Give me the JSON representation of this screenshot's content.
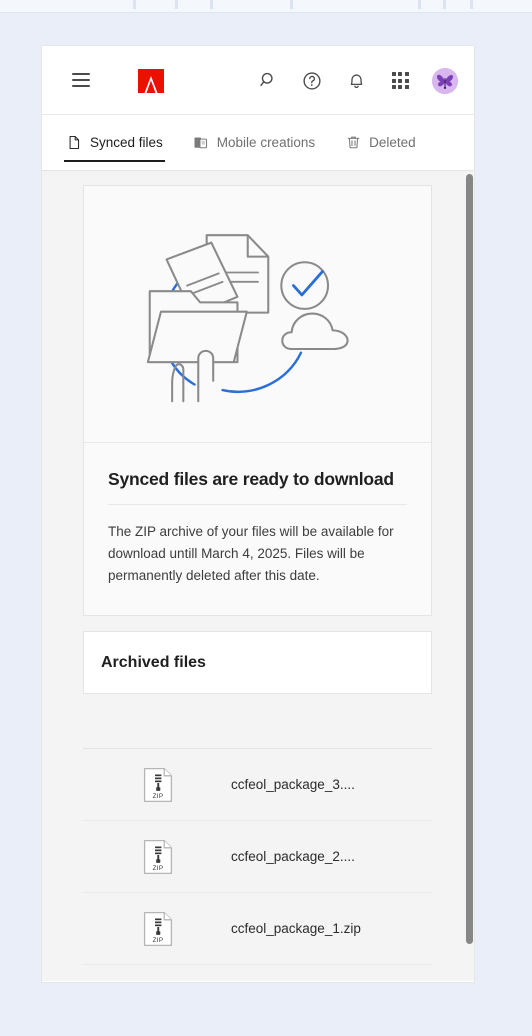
{
  "app": {
    "brand_logo": "adobe-logo",
    "accent_red": "#eb1000",
    "accent_blue": "#2a6fd6",
    "text_dark": "#1f1f1f",
    "text_muted": "#707070"
  },
  "header": {
    "menu_icon": "hamburger-menu-icon",
    "icons": [
      {
        "name": "search-icon",
        "label": "Search"
      },
      {
        "name": "help-icon",
        "label": "Help"
      },
      {
        "name": "notifications-bell-icon",
        "label": "Notifications"
      },
      {
        "name": "app-switcher-grid-icon",
        "label": "Apps"
      }
    ],
    "avatar": {
      "name": "user-avatar",
      "label": "Account"
    }
  },
  "tabs": [
    {
      "label": "Synced files",
      "icon": "document-icon",
      "active": true
    },
    {
      "label": "Mobile creations",
      "icon": "mobile-device-icon",
      "active": false
    },
    {
      "label": "Deleted",
      "icon": "trash-icon",
      "active": false
    }
  ],
  "hero": {
    "illustration": "sync-files-to-cloud-illustration",
    "title": "Synced files are ready to download",
    "body": "The ZIP archive of your files will be available for download untill March 4, 2025. Files will be permanently deleted after this date."
  },
  "archived": {
    "title": "Archived files"
  },
  "files": [
    {
      "name": "ccfeol_package_3....",
      "type": "ZIP",
      "icon": "zip-file-icon"
    },
    {
      "name": "ccfeol_package_2....",
      "type": "ZIP",
      "icon": "zip-file-icon"
    },
    {
      "name": "ccfeol_package_1.zip",
      "type": "ZIP",
      "icon": "zip-file-icon"
    }
  ],
  "scrollbar": {
    "name": "vertical-scrollbar"
  }
}
